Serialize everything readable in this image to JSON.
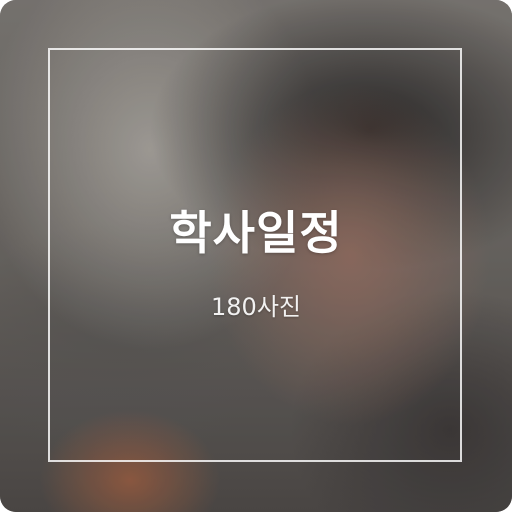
{
  "album": {
    "title": "학사일정",
    "photo_count": "180사진"
  },
  "colors": {
    "text": "#ffffff",
    "frame": "#ffffff"
  }
}
